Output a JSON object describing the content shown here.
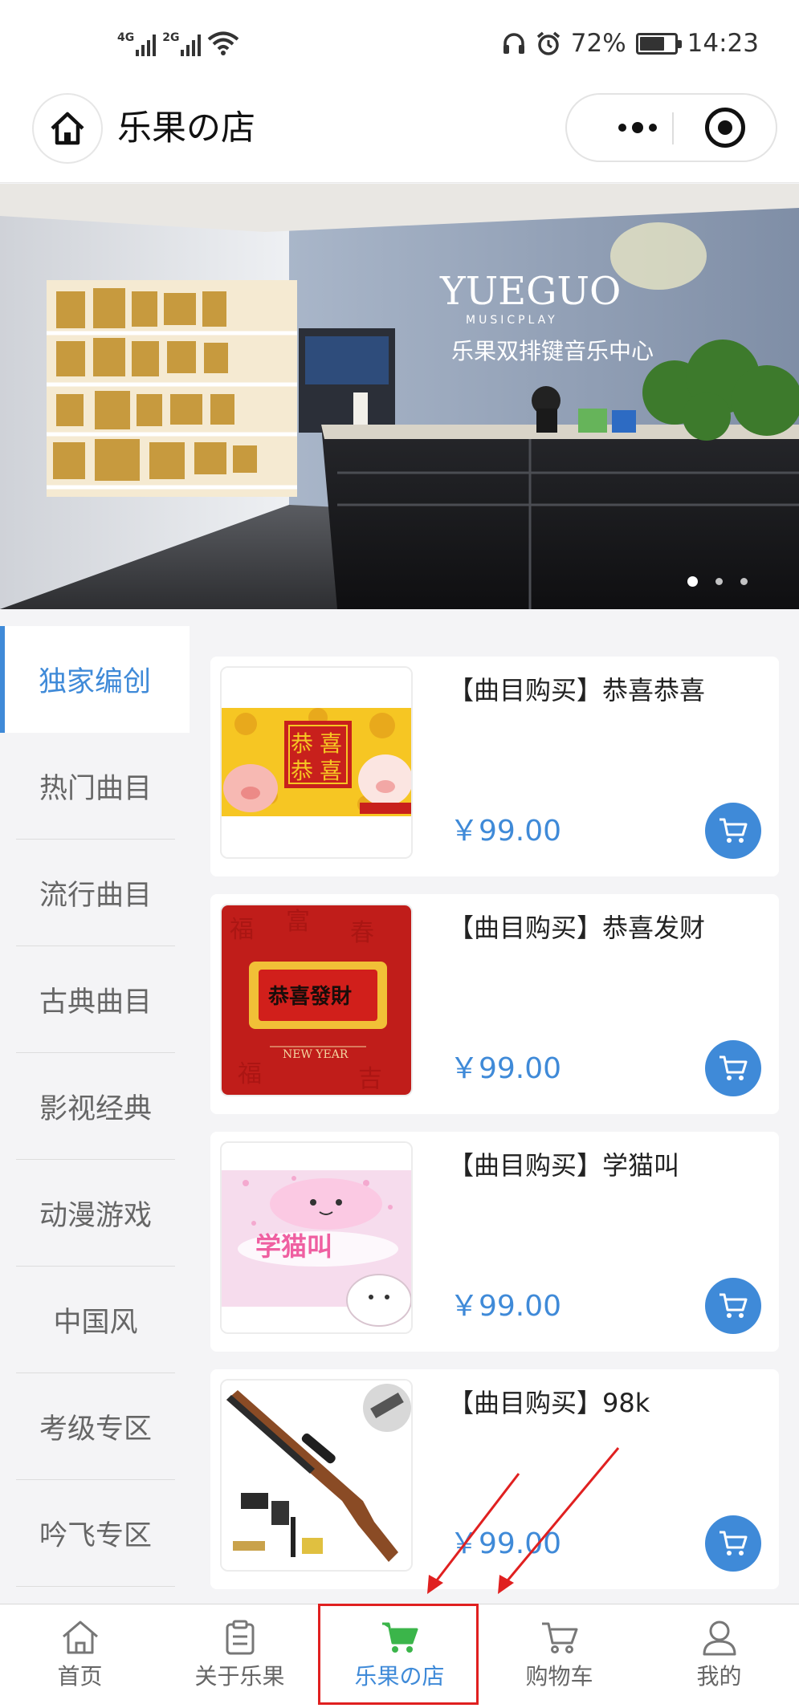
{
  "status_bar": {
    "net1": "4G",
    "net2": "2G",
    "battery": "72%",
    "battery_level": 0.72,
    "time": "14:23",
    "icons": [
      "signal-icon",
      "wifi-icon",
      "headset-icon",
      "alarm-icon",
      "battery-icon"
    ]
  },
  "header": {
    "title": "乐果の店",
    "home_icon": "home-icon",
    "more_icon": "more-icon",
    "close_icon": "target-close-icon"
  },
  "banner": {
    "sign_brand": "YUEGUO",
    "sign_sub": "MUSICPLAY",
    "sign_cn": "乐果双排键音乐中心",
    "slide_count": 3,
    "active_slide": 1
  },
  "categories": [
    {
      "label": "独家编创",
      "active": true
    },
    {
      "label": "热门曲目",
      "active": false
    },
    {
      "label": "流行曲目",
      "active": false
    },
    {
      "label": "古典曲目",
      "active": false
    },
    {
      "label": "影视经典",
      "active": false
    },
    {
      "label": "动漫游戏",
      "active": false
    },
    {
      "label": "中国风",
      "active": false
    },
    {
      "label": "考级专区",
      "active": false
    },
    {
      "label": "吟飞专区",
      "active": false
    }
  ],
  "products": [
    {
      "title": "【曲目购买】恭喜恭喜",
      "price": "￥99.00",
      "thumb_text": [
        "恭",
        "喜",
        "恭",
        "喜"
      ]
    },
    {
      "title": "【曲目购买】恭喜发财",
      "price": "￥99.00",
      "thumb_text": [
        "恭喜發財",
        "NEW YEAR"
      ]
    },
    {
      "title": "【曲目购买】学猫叫",
      "price": "￥99.00",
      "thumb_text": [
        "学猫叫"
      ]
    },
    {
      "title": "【曲目购买】98k",
      "price": "￥99.00",
      "thumb_text": []
    }
  ],
  "tabbar": [
    {
      "label": "首页",
      "icon": "home-icon",
      "active": false
    },
    {
      "label": "关于乐果",
      "icon": "clipboard-icon",
      "active": false
    },
    {
      "label": "乐果の店",
      "icon": "cart-icon",
      "active": true
    },
    {
      "label": "购物车",
      "icon": "cart-icon",
      "active": false
    },
    {
      "label": "我的",
      "icon": "user-icon",
      "active": false
    }
  ],
  "colors": {
    "accent": "#3f8ad8",
    "highlight": "#e02020",
    "text": "#222222",
    "muted": "#666666",
    "background": "#f4f4f6"
  }
}
